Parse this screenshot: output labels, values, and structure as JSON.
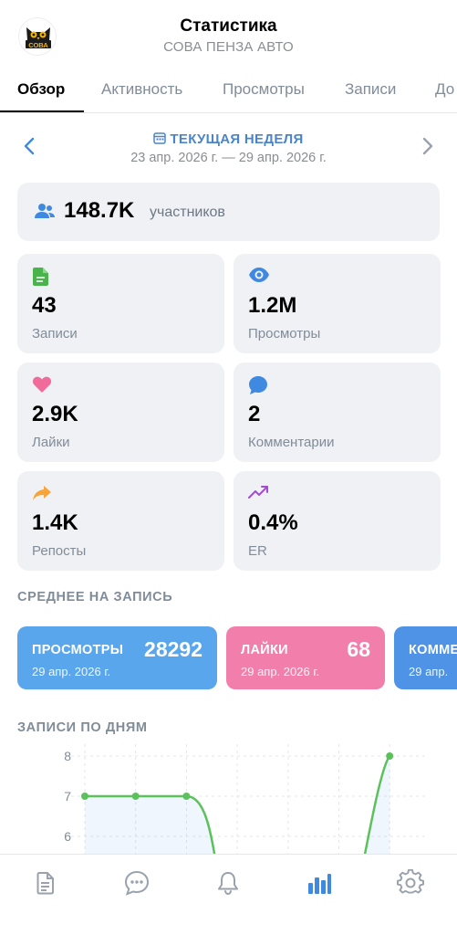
{
  "header": {
    "title": "Статистика",
    "subtitle": "СОВА ПЕНЗА АВТО",
    "avatar_text": "СОВА"
  },
  "tabs": [
    {
      "label": "Обзор",
      "active": true
    },
    {
      "label": "Активность",
      "active": false
    },
    {
      "label": "Просмотры",
      "active": false
    },
    {
      "label": "Записи",
      "active": false
    },
    {
      "label": "До",
      "active": false
    }
  ],
  "period": {
    "label": "ТЕКУЩАЯ НЕДЕЛЯ",
    "range": "23 апр. 2026 г. — 29 апр. 2026 г."
  },
  "members": {
    "value": "148.7K",
    "label": "участников"
  },
  "stats": [
    {
      "value": "43",
      "label": "Записи",
      "icon": "document-icon",
      "color": "#4bb34b"
    },
    {
      "value": "1.2M",
      "label": "Просмотры",
      "icon": "eye-icon",
      "color": "#3f8ae0"
    },
    {
      "value": "2.9K",
      "label": "Лайки",
      "icon": "heart-icon",
      "color": "#f06b99"
    },
    {
      "value": "2",
      "label": "Комментарии",
      "icon": "comment-icon",
      "color": "#3f8ae0"
    },
    {
      "value": "1.4K",
      "label": "Репосты",
      "icon": "share-icon",
      "color": "#f7a53a"
    },
    {
      "value": "0.4%",
      "label": "ER",
      "icon": "trend-icon",
      "color": "#a24cd1"
    }
  ],
  "average": {
    "title": "СРЕДНЕЕ НА ЗАПИСЬ",
    "cards": [
      {
        "label": "ПРОСМОТРЫ",
        "value": "28292",
        "date": "29 апр. 2026 г.",
        "color": "#5aa6ec"
      },
      {
        "label": "ЛАЙКИ",
        "value": "68",
        "date": "29 апр. 2026 г.",
        "color": "#f27fab"
      },
      {
        "label": "КОММЕ",
        "value": "",
        "date": "29 апр.",
        "color": "#4e93e6"
      }
    ]
  },
  "posts_chart": {
    "title": "ЗАПИСИ ПО ДНЯМ",
    "chart_data": {
      "type": "line",
      "y_ticks": [
        "8",
        "7",
        "6"
      ],
      "visible_ylim": [
        5.8,
        8.2
      ],
      "points": [
        {
          "x": 1,
          "y": 7
        },
        {
          "x": 2,
          "y": 7
        },
        {
          "x": 3,
          "y": 7
        },
        {
          "x": 7,
          "y": 8
        }
      ],
      "line_color": "#5bc25b",
      "grid": true
    }
  },
  "bottom_nav": [
    {
      "icon": "document-icon",
      "active": false
    },
    {
      "icon": "chat-icon",
      "active": false
    },
    {
      "icon": "bell-icon",
      "active": false
    },
    {
      "icon": "stats-icon",
      "active": true
    },
    {
      "icon": "gear-icon",
      "active": false
    }
  ]
}
